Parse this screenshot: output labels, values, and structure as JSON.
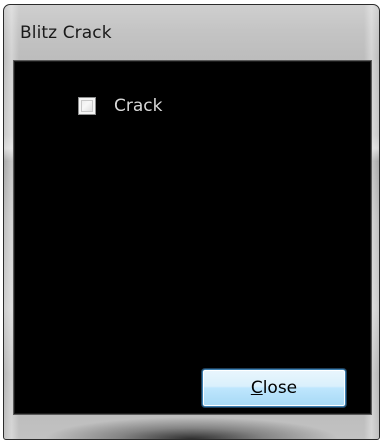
{
  "window": {
    "title": "Blitz Crack"
  },
  "checkbox": {
    "label": "Crack",
    "checked": false
  },
  "close_button": {
    "mnemonic": "C",
    "rest": "lose"
  },
  "colors": {
    "client_background": "#000000",
    "button_border": "#3c7fb1"
  }
}
